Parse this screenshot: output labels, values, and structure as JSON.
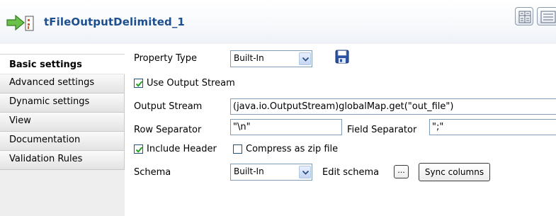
{
  "header": {
    "title": "tFileOutputDelimited_1"
  },
  "sidebar": {
    "items": [
      {
        "label": "Basic settings"
      },
      {
        "label": "Advanced settings"
      },
      {
        "label": "Dynamic settings"
      },
      {
        "label": "View"
      },
      {
        "label": "Documentation"
      },
      {
        "label": "Validation Rules"
      }
    ]
  },
  "form": {
    "property_type": {
      "label": "Property Type",
      "value": "Built-In"
    },
    "use_output_stream": {
      "label": "Use Output Stream",
      "checked": true
    },
    "output_stream": {
      "label": "Output Stream",
      "value": "(java.io.OutputStream)globalMap.get(\"out_file\")"
    },
    "row_separator": {
      "label": "Row Separator",
      "value": "\"\\n\""
    },
    "field_separator": {
      "label": "Field Separator",
      "value": "\";\""
    },
    "include_header": {
      "label": "Include Header",
      "checked": true
    },
    "compress_zip": {
      "label": "Compress as zip file",
      "checked": false
    },
    "schema": {
      "label": "Schema",
      "value": "Built-In",
      "edit_label": "Edit schema",
      "ellipsis": "...",
      "sync_label": "Sync columns"
    }
  },
  "colors": {
    "title": "#1d4f8f",
    "field_border": "#7f9db9",
    "checkmark": "#21a121"
  }
}
